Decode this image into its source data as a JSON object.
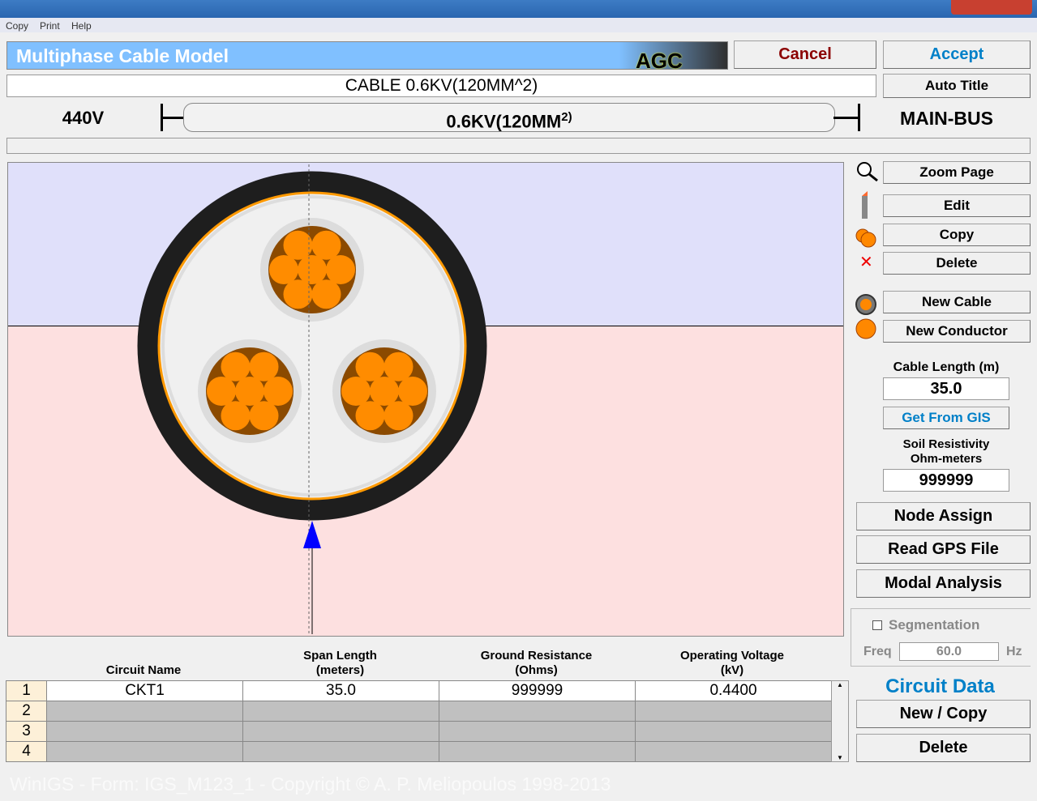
{
  "menu": [
    "Copy",
    "Print",
    "Help"
  ],
  "header": {
    "title": "Multiphase Cable Model",
    "logo": "AGC",
    "cancel": "Cancel",
    "accept": "Accept",
    "auto_title": "Auto Title"
  },
  "cable_title": "CABLE 0.6KV(120MM^2)",
  "bus": {
    "from": "440V",
    "cable": "0.6KV(120MM",
    "cable_sup": "2)",
    "to": "MAIN-BUS"
  },
  "side": {
    "zoom": "Zoom Page",
    "edit": "Edit",
    "copy": "Copy",
    "delete": "Delete",
    "new_cable": "New Cable",
    "new_conductor": "New Conductor",
    "length_label": "Cable Length (m)",
    "length": "35.0",
    "gis": "Get From GIS",
    "soil_label1": "Soil Resistivity",
    "soil_label2": "Ohm-meters",
    "soil": "999999",
    "node_assign": "Node Assign",
    "gps": "Read GPS File",
    "modal": "Modal Analysis",
    "segmentation": "Segmentation",
    "freq_label": "Freq",
    "freq": "60.0",
    "hz": "Hz",
    "circuit_data": "Circuit Data",
    "new_copy": "New / Copy",
    "delete2": "Delete"
  },
  "table": {
    "headers": [
      [
        "Circuit Name",
        ""
      ],
      [
        "Span Length",
        "(meters)"
      ],
      [
        "Ground Resistance",
        "(Ohms)"
      ],
      [
        "Operating Voltage",
        "(kV)"
      ]
    ],
    "rows": [
      [
        "1",
        "CKT1",
        "35.0",
        "999999",
        "0.4400"
      ],
      [
        "2",
        "",
        "",
        "",
        ""
      ],
      [
        "3",
        "",
        "",
        "",
        ""
      ],
      [
        "4",
        "",
        "",
        "",
        ""
      ]
    ]
  },
  "footer": "WinIGS - Form: IGS_M123_1 - Copyright © A. P. Meliopoulos 1998-2013",
  "colors": {
    "accent": "#0080c8",
    "cancel": "#8b0000",
    "conductor": "#ff8c00",
    "core": "#8b4a00"
  }
}
